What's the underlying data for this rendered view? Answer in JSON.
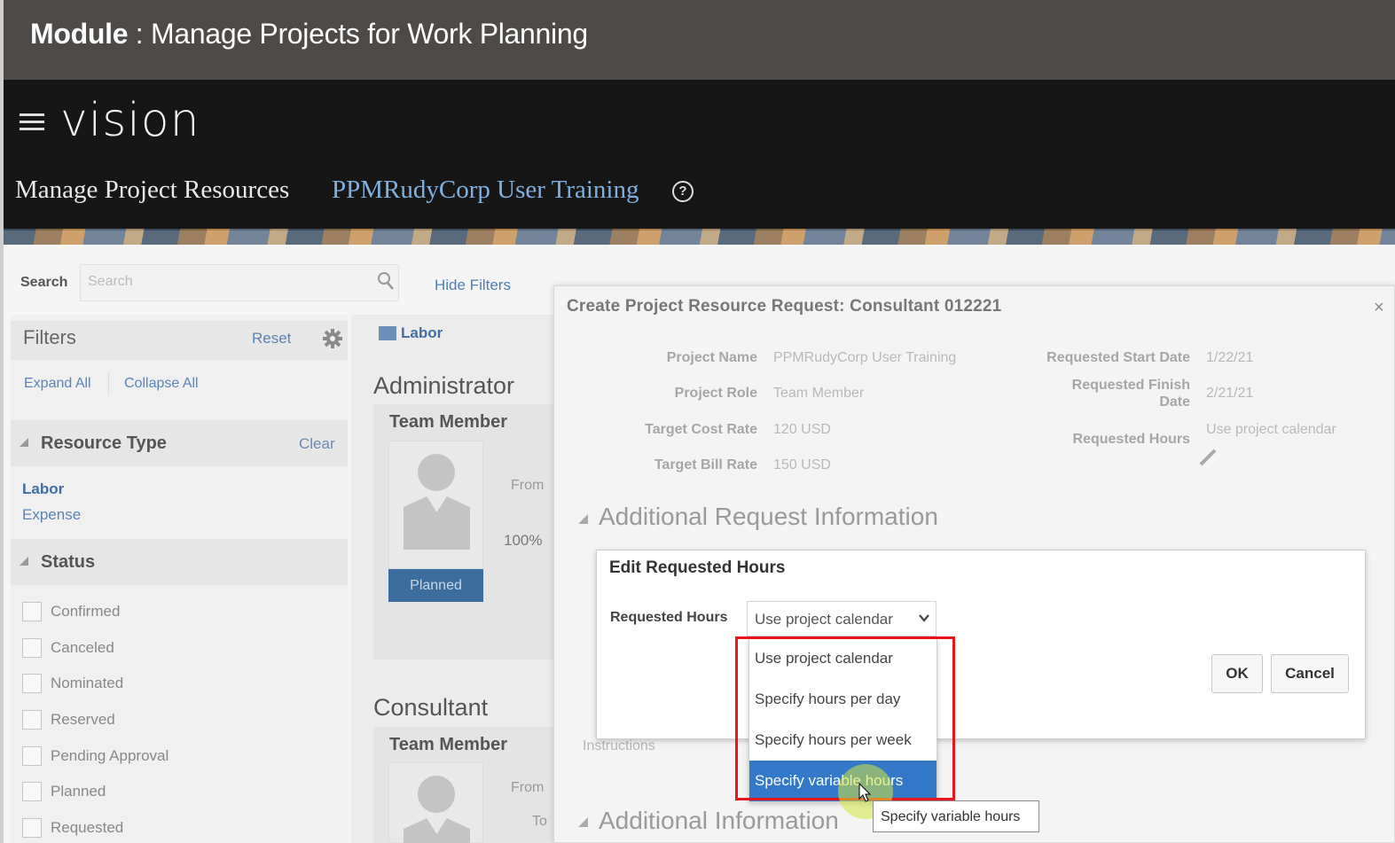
{
  "module_banner": {
    "label": "Module",
    "separator": " : ",
    "title": "Manage Projects for Work Planning"
  },
  "header": {
    "logo": "vision",
    "page_title": "Manage Project Resources",
    "project_name": "PPMRudyCorp User Training"
  },
  "search": {
    "label": "Search",
    "placeholder": "Search",
    "hide_filters": "Hide Filters"
  },
  "filters": {
    "title": "Filters",
    "reset": "Reset",
    "expand_all": "Expand All",
    "collapse_all": "Collapse All",
    "resource_type": {
      "title": "Resource Type",
      "clear": "Clear",
      "items": [
        "Labor",
        "Expense"
      ]
    },
    "status": {
      "title": "Status",
      "items": [
        "Confirmed",
        "Canceled",
        "Nominated",
        "Reserved",
        "Pending Approval",
        "Planned",
        "Requested"
      ]
    }
  },
  "main": {
    "tab": "Labor",
    "groups": [
      {
        "heading": "Administrator",
        "card_title": "Team Member",
        "from": "From",
        "percent": "100%",
        "status_button": "Planned"
      },
      {
        "heading": "Consultant",
        "card_title": "Team Member",
        "from": "From",
        "to": "To"
      }
    ]
  },
  "create_dialog": {
    "title": "Create Project Resource Request: Consultant 012221",
    "close": "×",
    "fields_left": [
      {
        "label": "Project Name",
        "value": "PPMRudyCorp User Training"
      },
      {
        "label": "Project Role",
        "value": "Team Member"
      },
      {
        "label": "Target Cost Rate",
        "value": "120  USD"
      },
      {
        "label": "Target Bill Rate",
        "value": "150  USD"
      }
    ],
    "fields_right": [
      {
        "label": "Requested Start Date",
        "value": "1/22/21"
      },
      {
        "label": "Requested Finish Date",
        "value": "2/21/21"
      },
      {
        "label": "Requested Hours",
        "value": "Use project calendar"
      }
    ],
    "section_additional_request": "Additional Request Information",
    "instructions": "Instructions",
    "section_additional": "Additional Information"
  },
  "edit_dialog": {
    "title": "Edit Requested Hours",
    "requested_hours_label": "Requested Hours",
    "requested_hours_value": "Use project calendar",
    "options": [
      "Use project calendar",
      "Specify hours per day",
      "Specify hours per week",
      "Specify variable hours"
    ],
    "selected_index": 3,
    "ok": "OK",
    "cancel": "Cancel",
    "tooltip": "Specify variable hours"
  },
  "colors": {
    "accent": "#3479c8",
    "highlight": "#e8141b",
    "banner": "#4d4a47",
    "header": "#161616"
  }
}
